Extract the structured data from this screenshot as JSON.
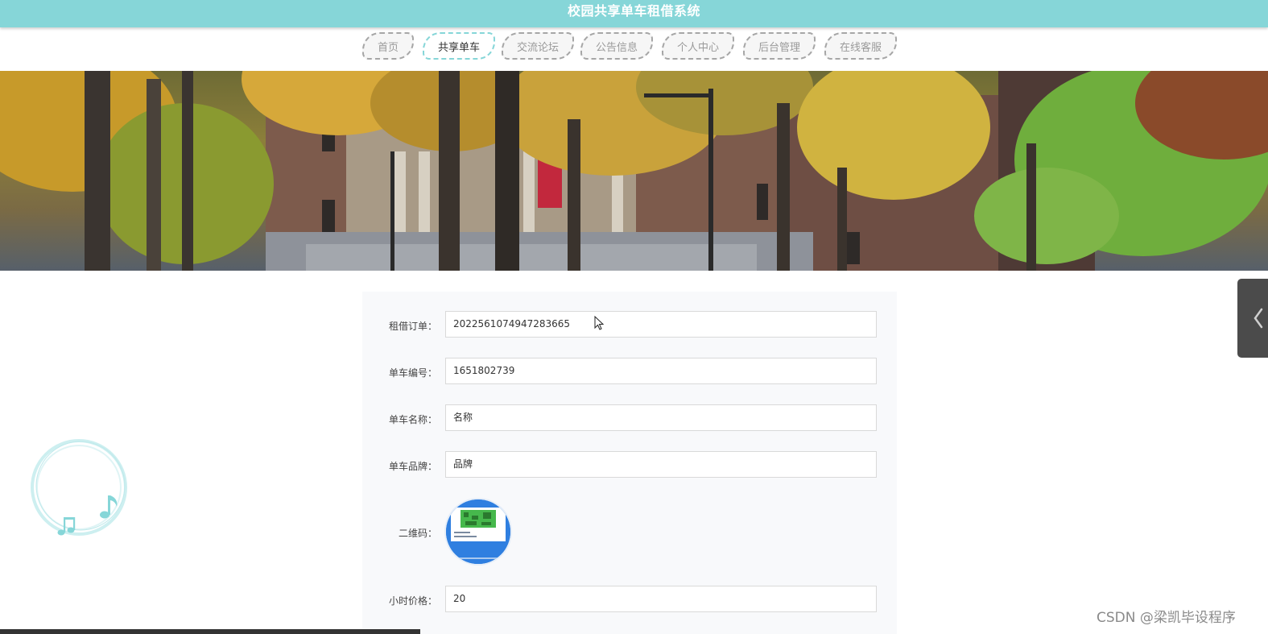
{
  "header": {
    "title": "校园共享单车租借系统",
    "background_color": "#86d6d8"
  },
  "nav": {
    "active_color": "#86d6d8",
    "items": [
      {
        "label": "首页"
      },
      {
        "label": "共享单车",
        "active": true
      },
      {
        "label": "交流论坛"
      },
      {
        "label": "公告信息"
      },
      {
        "label": "个人中心"
      },
      {
        "label": "后台管理"
      },
      {
        "label": "在线客服"
      }
    ]
  },
  "banner": {
    "icon": "campus-photo"
  },
  "form": {
    "order": {
      "label": "租借订单：",
      "value": "2022561074947283665"
    },
    "bike_no": {
      "label": "单车编号：",
      "value": "1651802739"
    },
    "bike_name": {
      "label": "单车名称：",
      "value": "名称"
    },
    "bike_brand": {
      "label": "单车品牌：",
      "value": "品牌"
    },
    "qrcode": {
      "label": "二维码：",
      "icon": "qr-code-image"
    },
    "hour_price": {
      "label": "小时价格：",
      "value": "20"
    }
  },
  "music_player": {
    "icon": "music-note-icon"
  },
  "side_tab": {
    "icon": "chevron-left-icon"
  },
  "watermark": "CSDN @梁凯毕设程序"
}
